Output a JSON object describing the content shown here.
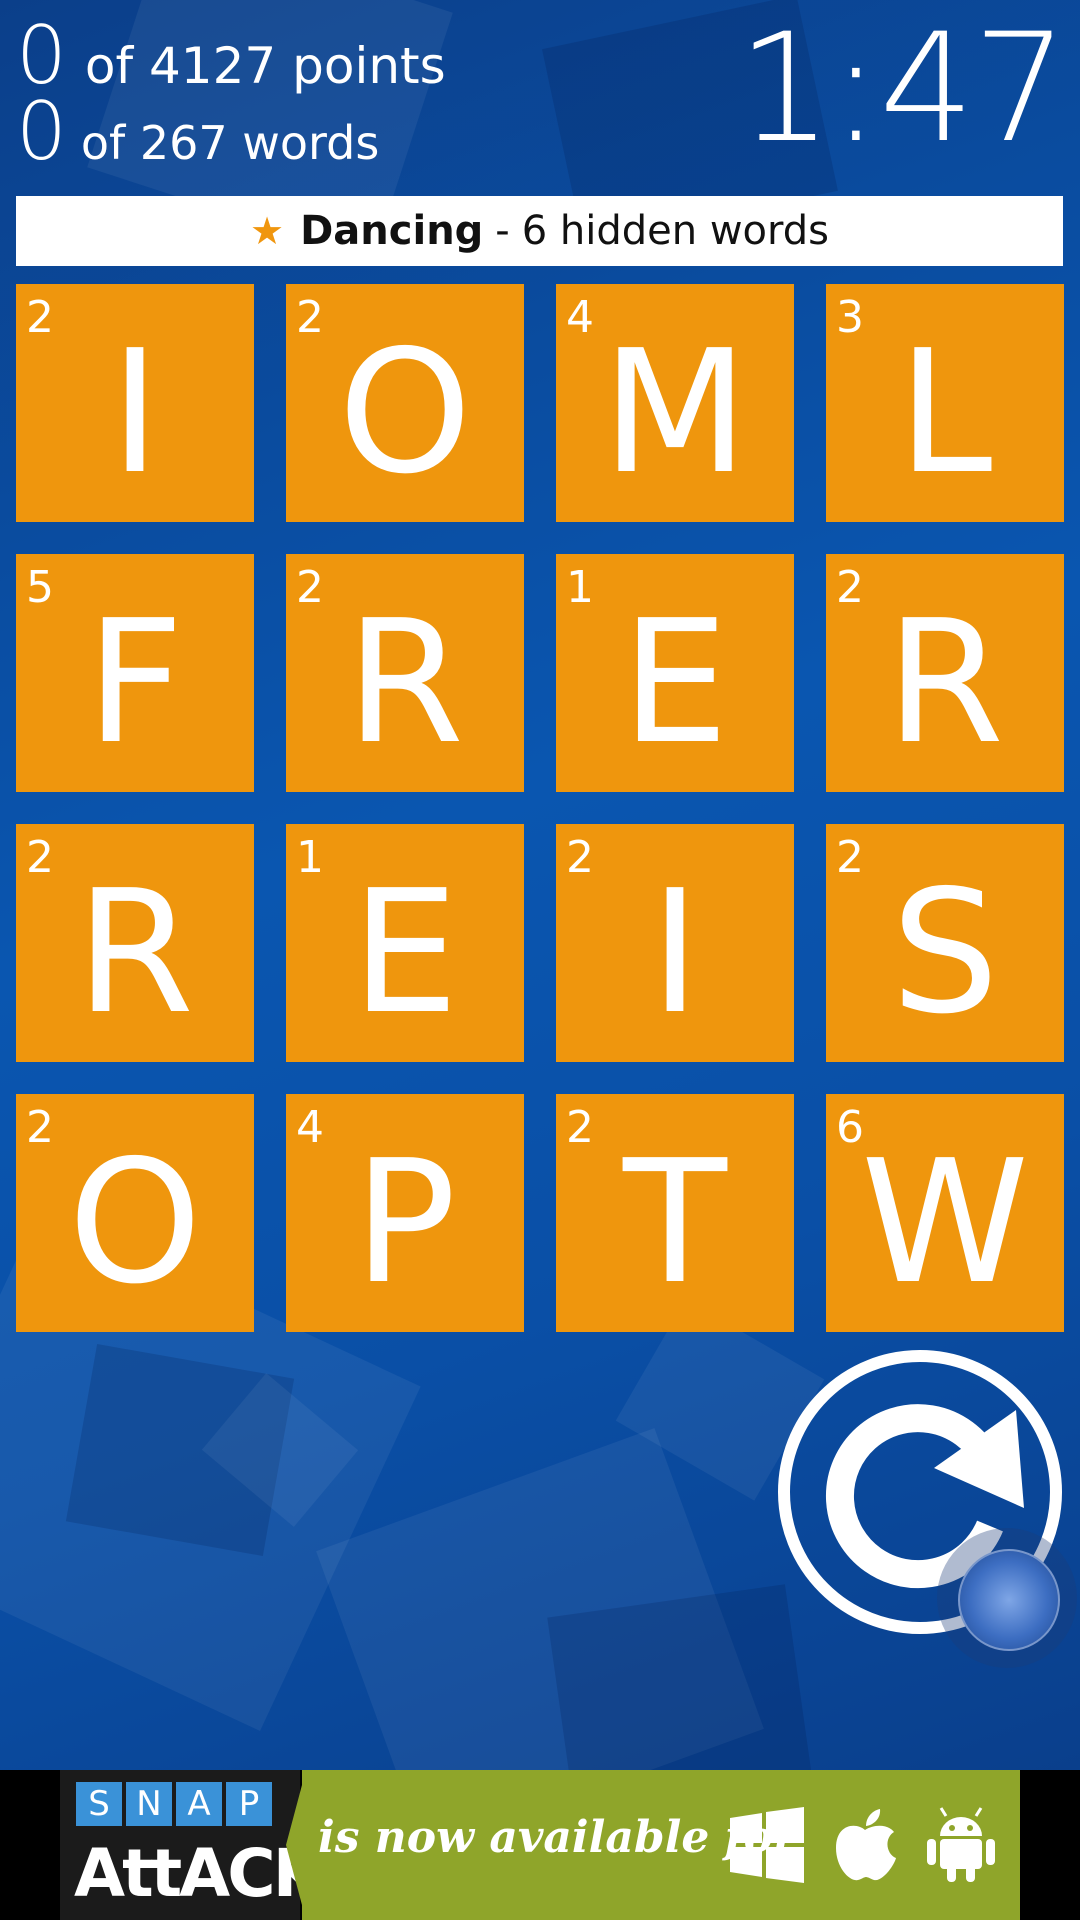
{
  "stats": {
    "points_value": "0",
    "points_label": "of 4127 points",
    "words_value": "0",
    "words_label": "of 267 words"
  },
  "timer": "1:47",
  "theme": {
    "star": "★",
    "name": "Dancing",
    "separator": "-",
    "hidden_words": "6 hidden words"
  },
  "board": [
    {
      "letter": "I",
      "score": "2"
    },
    {
      "letter": "O",
      "score": "2"
    },
    {
      "letter": "M",
      "score": "4"
    },
    {
      "letter": "L",
      "score": "3"
    },
    {
      "letter": "F",
      "score": "5"
    },
    {
      "letter": "R",
      "score": "2"
    },
    {
      "letter": "E",
      "score": "1"
    },
    {
      "letter": "R",
      "score": "2"
    },
    {
      "letter": "R",
      "score": "2"
    },
    {
      "letter": "E",
      "score": "1"
    },
    {
      "letter": "I",
      "score": "2"
    },
    {
      "letter": "S",
      "score": "2"
    },
    {
      "letter": "O",
      "score": "2"
    },
    {
      "letter": "P",
      "score": "4"
    },
    {
      "letter": "T",
      "score": "2"
    },
    {
      "letter": "W",
      "score": "6"
    }
  ],
  "refresh_icon": "refresh-icon",
  "ad": {
    "snap_letters": [
      "S",
      "N",
      "A",
      "P"
    ],
    "attack": "AttACK",
    "tagline": "is now available for",
    "platform_icons": [
      "windows-icon",
      "apple-icon",
      "android-icon"
    ]
  },
  "colors": {
    "tile": "#ef960d",
    "background": "#0a4a9a",
    "star": "#f0960e",
    "ad_green": "#8fa52a"
  }
}
